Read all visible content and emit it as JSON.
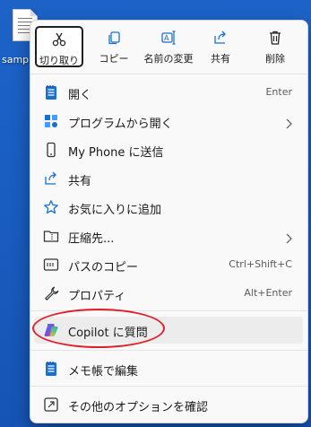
{
  "desktop": {
    "file_name": "sampl"
  },
  "toolbar": [
    {
      "id": "cut",
      "label": "切り取り",
      "icon": "scissors-icon",
      "active": true
    },
    {
      "id": "copy",
      "label": "コピー",
      "icon": "copy-icon"
    },
    {
      "id": "rename",
      "label": "名前の変更",
      "icon": "rename-icon"
    },
    {
      "id": "share",
      "label": "共有",
      "icon": "share-icon"
    },
    {
      "id": "delete",
      "label": "削除",
      "icon": "trash-icon"
    }
  ],
  "items": [
    {
      "label": "開く",
      "shortcut": "Enter",
      "icon": "notepad-icon"
    },
    {
      "label": "プログラムから開く",
      "submenu": true,
      "icon": "open-with-icon"
    },
    {
      "label": "My Phone に送信",
      "icon": "phone-icon"
    },
    {
      "label": "共有",
      "icon": "share-icon"
    },
    {
      "label": "お気に入りに追加",
      "icon": "star-icon"
    },
    {
      "label": "圧縮先...",
      "submenu": true,
      "icon": "zip-folder-icon"
    },
    {
      "label": "パスのコピー",
      "shortcut": "Ctrl+Shift+C",
      "icon": "path-copy-icon"
    },
    {
      "label": "プロパティ",
      "shortcut": "Alt+Enter",
      "icon": "wrench-icon"
    },
    {
      "label": "Copilot に質問",
      "icon": "copilot-icon",
      "hover": true,
      "highlighted": true
    },
    {
      "label": "メモ帳で編集",
      "icon": "notepad-icon"
    },
    {
      "label": "その他のオプションを確認",
      "icon": "more-options-icon"
    }
  ],
  "colors": {
    "accent": "#1a6fd1",
    "highlight_ring": "#e0202a",
    "menu_bg": "#f9f9f9",
    "desktop": "#1a5ec2"
  }
}
